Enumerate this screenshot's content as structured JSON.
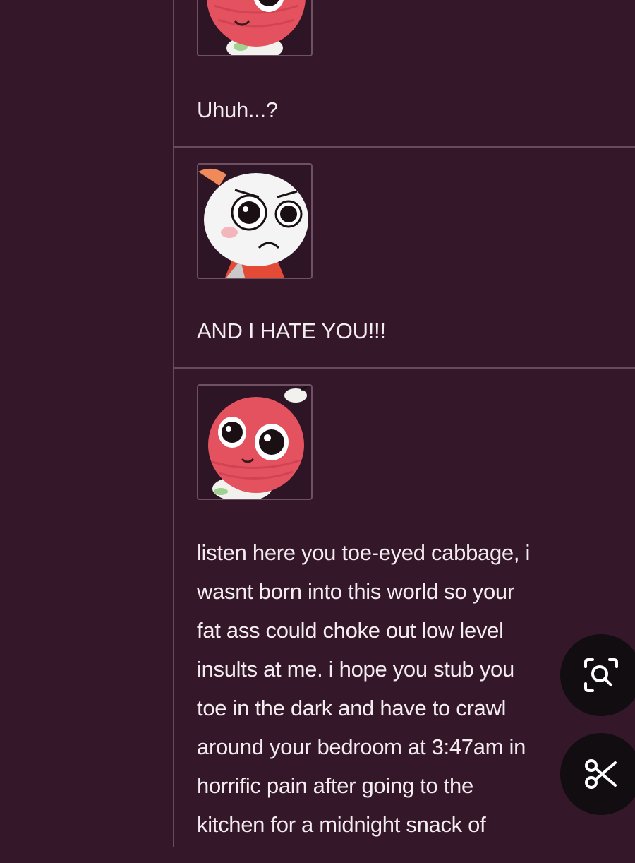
{
  "thread": {
    "posts": [
      {
        "avatar_icon": "red-ball-character-avatar",
        "text": "Uhuh...?"
      },
      {
        "avatar_icon": "angry-white-character-avatar",
        "text": "AND I HATE YOU!!!"
      },
      {
        "avatar_icon": "red-ball-character-avatar",
        "text_lines": [
          "listen here you toe-eyed cabbage, i",
          "wasnt born into this world so your",
          "fat ass could choke out low level",
          "insults at me. i hope you stub you",
          "toe in the dark and have to crawl",
          "around your bedroom at 3:47am in",
          "horrific pain after going to the",
          "kitchen for a midnight snack of"
        ]
      }
    ]
  },
  "overlay": {
    "buttons": [
      {
        "icon": "lens-search-icon"
      },
      {
        "icon": "scissors-icon"
      }
    ]
  },
  "colors": {
    "background": "#35172a",
    "divider": "#6a4a5c",
    "text": "#f3ecf0",
    "overlay_button": "#120d10"
  }
}
